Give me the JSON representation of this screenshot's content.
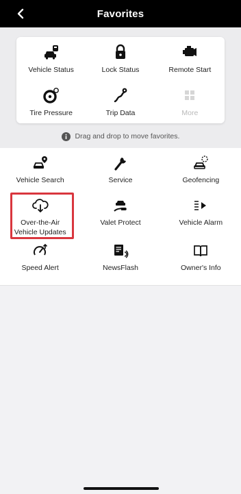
{
  "header": {
    "title": "Favorites",
    "back_icon": "chevron-left-icon"
  },
  "favorites": [
    {
      "label": "Vehicle Status",
      "icon": "car-status-icon"
    },
    {
      "label": "Lock Status",
      "icon": "lock-icon"
    },
    {
      "label": "Remote Start",
      "icon": "engine-icon"
    },
    {
      "label": "Tire Pressure",
      "icon": "tire-pressure-icon"
    },
    {
      "label": "Trip Data",
      "icon": "trip-route-icon"
    },
    {
      "label": "More",
      "icon": "grid-icon",
      "disabled": true
    }
  ],
  "hint": {
    "text": "Drag and drop to move favorites.",
    "icon": "info-icon"
  },
  "more_items": [
    {
      "label": "Vehicle Search",
      "icon": "car-location-icon"
    },
    {
      "label": "Service",
      "icon": "wrench-icon"
    },
    {
      "label": "Geofencing",
      "icon": "car-geofence-icon"
    },
    {
      "label": "Over-the-Air",
      "label2": "Vehicle Updates",
      "icon": "cloud-download-icon"
    },
    {
      "label": "Valet Protect",
      "icon": "valet-hand-car-icon"
    },
    {
      "label": "Vehicle Alarm",
      "icon": "alarm-horn-icon"
    },
    {
      "label": "Speed Alert",
      "icon": "speedometer-icon"
    },
    {
      "label": "NewsFlash",
      "icon": "news-audio-icon"
    },
    {
      "label": "Owner's Info",
      "icon": "book-icon"
    }
  ],
  "colors": {
    "header_bg": "#000000",
    "highlight": "#d9363e",
    "disabled": "#b8b8b8"
  }
}
